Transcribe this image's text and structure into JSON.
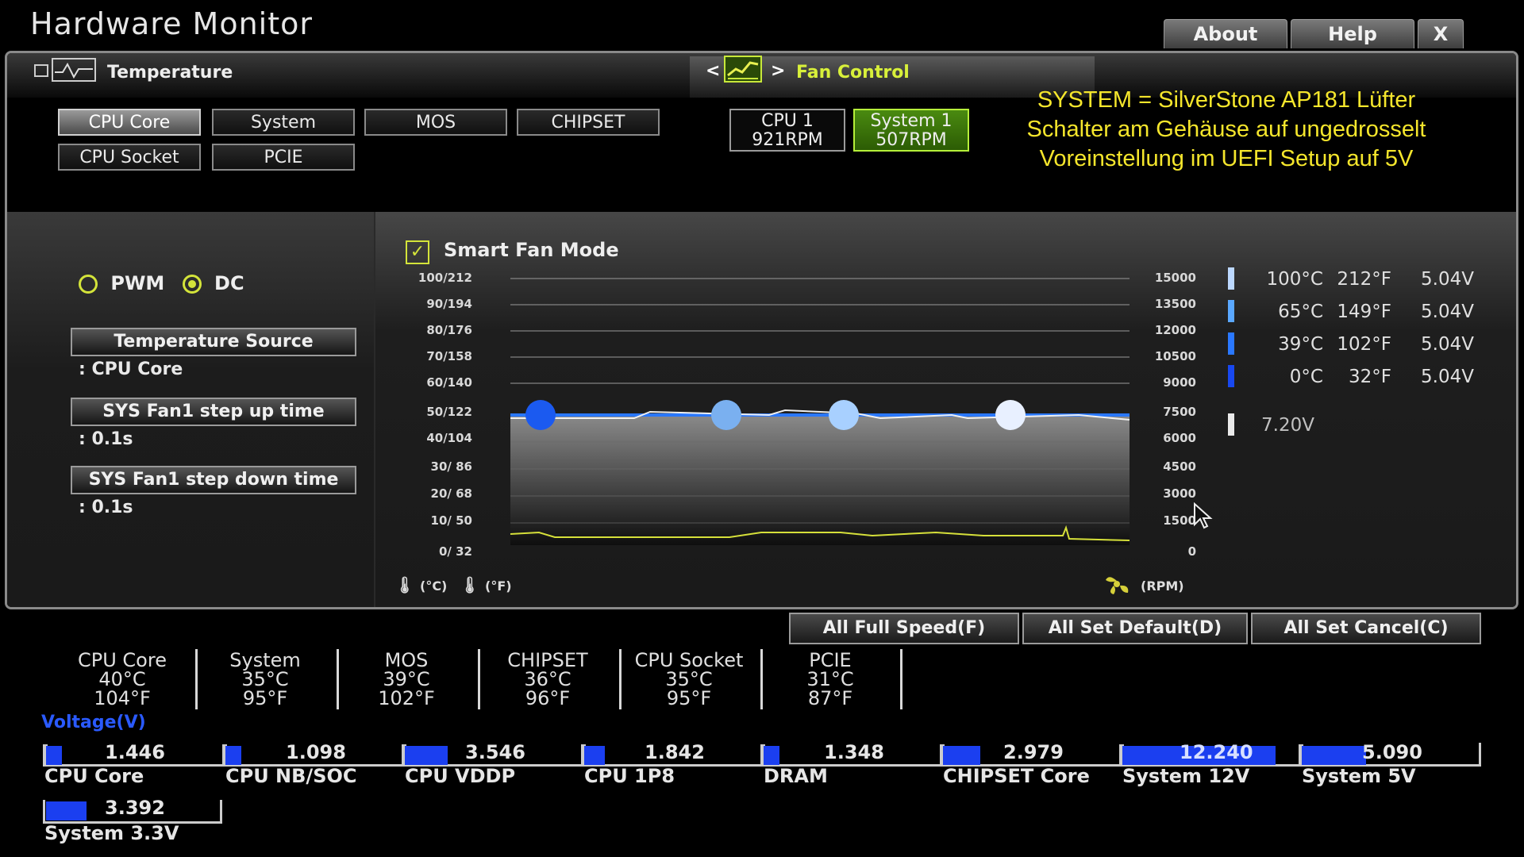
{
  "app": {
    "title": "Hardware Monitor",
    "top_buttons": [
      "About",
      "Help",
      "X"
    ]
  },
  "temperature": {
    "label": "Temperature",
    "sources": [
      "CPU Core",
      "System",
      "MOS",
      "CHIPSET",
      "CPU Socket",
      "PCIE"
    ],
    "selected": "CPU Core"
  },
  "fan_control": {
    "label": "Fan Control",
    "fans": [
      {
        "name": "CPU 1",
        "rpm": "921RPM"
      },
      {
        "name": "System 1",
        "rpm": "507RPM"
      }
    ],
    "selected": "System 1"
  },
  "annotation": {
    "line1": "SYSTEM = SilverStone AP181 Lüfter",
    "line2": "Schalter am Gehäuse auf ungedrosselt",
    "line3": "Voreinstellung im UEFI Setup auf 5V"
  },
  "settings": {
    "mode_pwm": "PWM",
    "mode_dc": "DC",
    "mode_selected": "DC",
    "temp_source_label": "Temperature Source",
    "temp_source_value": ": CPU Core",
    "step_up_label": "SYS Fan1 step up time",
    "step_up_value": ": 0.1s",
    "step_down_label": "SYS Fan1 step down time",
    "step_down_value": ": 0.1s"
  },
  "smart_fan": {
    "label": "Smart Fan Mode",
    "checked": true,
    "left_axis": [
      "100/212",
      "90/194",
      "80/176",
      "70/158",
      "60/140",
      "50/122",
      "40/104",
      "30/ 86",
      "20/ 68",
      "10/ 50",
      "0/ 32"
    ],
    "right_axis": [
      "15000",
      "13500",
      "12000",
      "10500",
      "9000",
      "7500",
      "6000",
      "4500",
      "3000",
      "1500",
      "0"
    ],
    "unit_c": "(°C)",
    "unit_f": "(°F)",
    "unit_rpm": "(RPM)",
    "curve_points": [
      {
        "temp_c": 0,
        "volt": 5.04
      },
      {
        "temp_c": 39,
        "volt": 5.04
      },
      {
        "temp_c": 65,
        "volt": 5.04
      },
      {
        "temp_c": 100,
        "volt": 5.04
      }
    ],
    "legend": [
      {
        "c": "100°C",
        "f": "212°F",
        "v": "5.04V",
        "color": "#bcd8ff"
      },
      {
        "c": "65°C",
        "f": "149°F",
        "v": "5.04V",
        "color": "#5aa8ff"
      },
      {
        "c": "39°C",
        "f": "102°F",
        "v": "5.04V",
        "color": "#2a78ff"
      },
      {
        "c": "0°C",
        "f": "32°F",
        "v": "5.04V",
        "color": "#1848f0"
      }
    ],
    "max_voltage": "7.20V"
  },
  "actions": {
    "full_speed": "All Full Speed(F)",
    "set_default": "All Set Default(D)",
    "set_cancel": "All Set Cancel(C)"
  },
  "temps": [
    {
      "name": "CPU Core",
      "c": "40°C",
      "f": "104°F"
    },
    {
      "name": "System",
      "c": "35°C",
      "f": "95°F"
    },
    {
      "name": "MOS",
      "c": "39°C",
      "f": "102°F"
    },
    {
      "name": "CHIPSET",
      "c": "36°C",
      "f": "96°F"
    },
    {
      "name": "CPU Socket",
      "c": "35°C",
      "f": "95°F"
    },
    {
      "name": "PCIE",
      "c": "31°C",
      "f": "87°F"
    }
  ],
  "voltage": {
    "label": "Voltage(V)",
    "items": [
      {
        "name": "CPU Core",
        "value": "1.446",
        "level": 0.05
      },
      {
        "name": "CPU NB/SOC",
        "value": "1.098",
        "level": 0.05
      },
      {
        "name": "CPU VDDP",
        "value": "3.546",
        "level": 0.25
      },
      {
        "name": "CPU 1P8",
        "value": "1.842",
        "level": 0.12
      },
      {
        "name": "DRAM",
        "value": "1.348",
        "level": 0.05
      },
      {
        "name": "CHIPSET Core",
        "value": "2.979",
        "level": 0.22
      },
      {
        "name": "System 12V",
        "value": "12.240",
        "level": 0.9
      },
      {
        "name": "System 5V",
        "value": "5.090",
        "level": 0.38
      },
      {
        "name": "System 3.3V",
        "value": "3.392",
        "level": 0.24
      }
    ]
  },
  "colors": {
    "accent_yellow": "#f5e62c",
    "selected_green": "#b6f03a",
    "voltage_blue": "#1b3ff0",
    "fan_rpm_line": "#d6e03a"
  }
}
